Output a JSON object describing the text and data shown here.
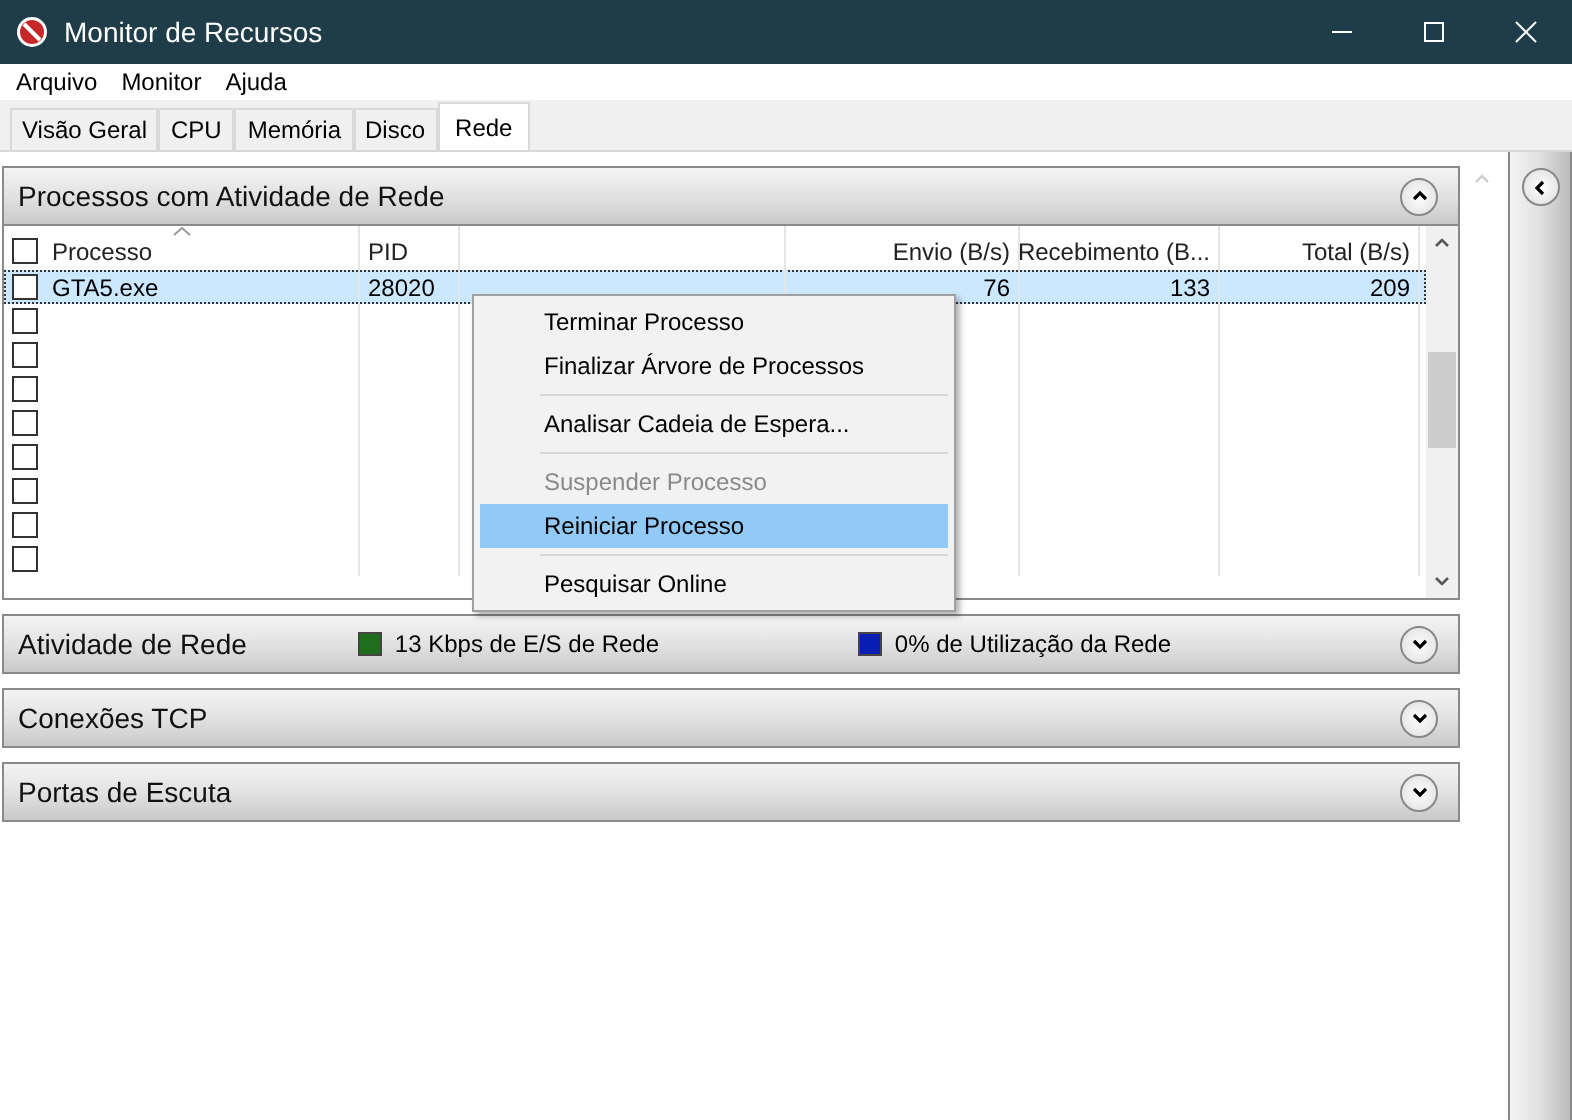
{
  "window": {
    "title": "Monitor de Recursos"
  },
  "menu": [
    "Arquivo",
    "Monitor",
    "Ajuda"
  ],
  "tabs": [
    {
      "label": "Visão Geral",
      "selected": false
    },
    {
      "label": "CPU",
      "selected": false
    },
    {
      "label": "Memória",
      "selected": false
    },
    {
      "label": "Disco",
      "selected": false
    },
    {
      "label": "Rede",
      "selected": true
    }
  ],
  "processes": {
    "title": "Processos com Atividade de Rede",
    "expanded": true,
    "header_checked": false,
    "columns": [
      {
        "kind": "text",
        "label": "Processo"
      },
      {
        "kind": "text",
        "label": "PID"
      },
      {
        "kind": "text"
      },
      {
        "kind": "number",
        "label": "Envio (B/s)"
      },
      {
        "kind": "number",
        "label": "Recebimento (B..."
      },
      {
        "kind": "number",
        "label": "Total (B/s)"
      }
    ],
    "rows": [
      {
        "checked": false,
        "selected": true,
        "cells": [
          "GTA5.exe",
          "28020",
          "",
          "76",
          "133",
          "209"
        ]
      },
      {
        "checked": false,
        "selected": false,
        "cells": []
      },
      {
        "checked": false,
        "selected": false,
        "cells": []
      },
      {
        "checked": false,
        "selected": false,
        "cells": []
      },
      {
        "checked": false,
        "selected": false,
        "cells": []
      },
      {
        "checked": false,
        "selected": false,
        "cells": []
      },
      {
        "checked": false,
        "selected": false,
        "cells": []
      },
      {
        "checked": false,
        "selected": false,
        "cells": []
      },
      {
        "checked": false,
        "selected": false,
        "cells": []
      }
    ]
  },
  "context_menu": [
    {
      "kind": "item",
      "label": "Terminar Processo",
      "disabled": false,
      "selected": false
    },
    {
      "kind": "item",
      "label": "Finalizar Árvore de Processos",
      "disabled": false,
      "selected": false
    },
    {
      "kind": "separator"
    },
    {
      "kind": "item",
      "label": "Analisar Cadeia de Espera...",
      "disabled": false,
      "selected": false
    },
    {
      "kind": "separator"
    },
    {
      "kind": "item",
      "label": "Suspender Processo",
      "disabled": true,
      "selected": false
    },
    {
      "kind": "item",
      "label": "Reiniciar Processo",
      "disabled": false,
      "selected": true
    },
    {
      "kind": "separator"
    },
    {
      "kind": "item",
      "label": "Pesquisar Online",
      "disabled": false,
      "selected": false
    }
  ],
  "sections": [
    {
      "title": "Atividade de Rede",
      "expanded": false,
      "legends": [
        {
          "label": "13 Kbps de E/S de Rede",
          "color": "#1e6e1e"
        },
        {
          "label": "0% de Utilização da Rede",
          "color": "#0a1eb4"
        }
      ]
    },
    {
      "title": "Conexões TCP",
      "expanded": false
    },
    {
      "title": "Portas de Escuta",
      "expanded": false
    }
  ]
}
